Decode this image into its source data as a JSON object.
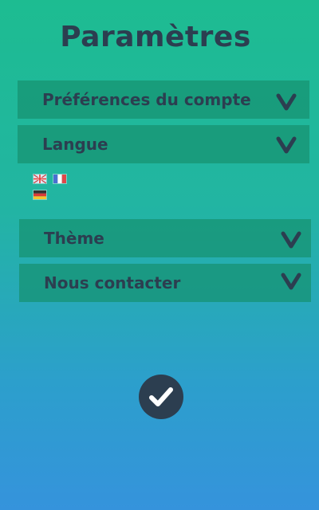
{
  "page": {
    "title": "Paramètres"
  },
  "sections": [
    {
      "id": "account",
      "label": "Préférences du compte",
      "icon": "chevron-down-icon",
      "expanded": false
    },
    {
      "id": "language",
      "label": "Langue",
      "icon": "chevron-down-icon",
      "expanded": true
    },
    {
      "id": "theme",
      "label": "Thème",
      "icon": "chevron-down-icon",
      "expanded": false
    },
    {
      "id": "contact",
      "label": "Nous contacter",
      "icon": "chevron-down-icon",
      "expanded": false
    }
  ],
  "language_options": [
    {
      "code": "en",
      "icon": "uk-flag-icon"
    },
    {
      "code": "fr",
      "icon": "france-flag-icon"
    },
    {
      "code": "de",
      "icon": "germany-flag-icon"
    }
  ],
  "confirm": {
    "icon": "checkmark-icon"
  },
  "colors": {
    "gradient_top": "#1dbc91",
    "gradient_bottom": "#3593dc",
    "section_bg": "#169170",
    "text": "#2c3e50",
    "confirm_bg": "#2c3e50",
    "confirm_icon": "#ffffff"
  }
}
